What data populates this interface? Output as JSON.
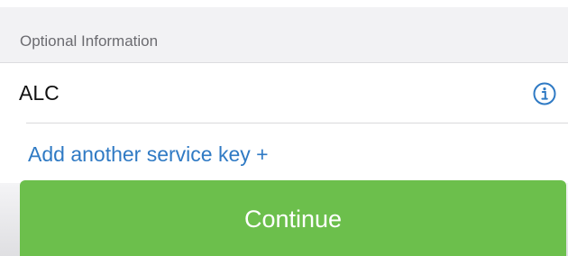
{
  "section": {
    "title": "Optional Information"
  },
  "service_key": {
    "label": "ALC",
    "info_icon": "info-circle-icon"
  },
  "add_link": {
    "label": "Add another service key +"
  },
  "footer": {
    "continue_label": "Continue"
  },
  "colors": {
    "accent_blue": "#2f7ac4",
    "button_green": "#6cbf4c",
    "section_bg": "#f2f2f4"
  }
}
